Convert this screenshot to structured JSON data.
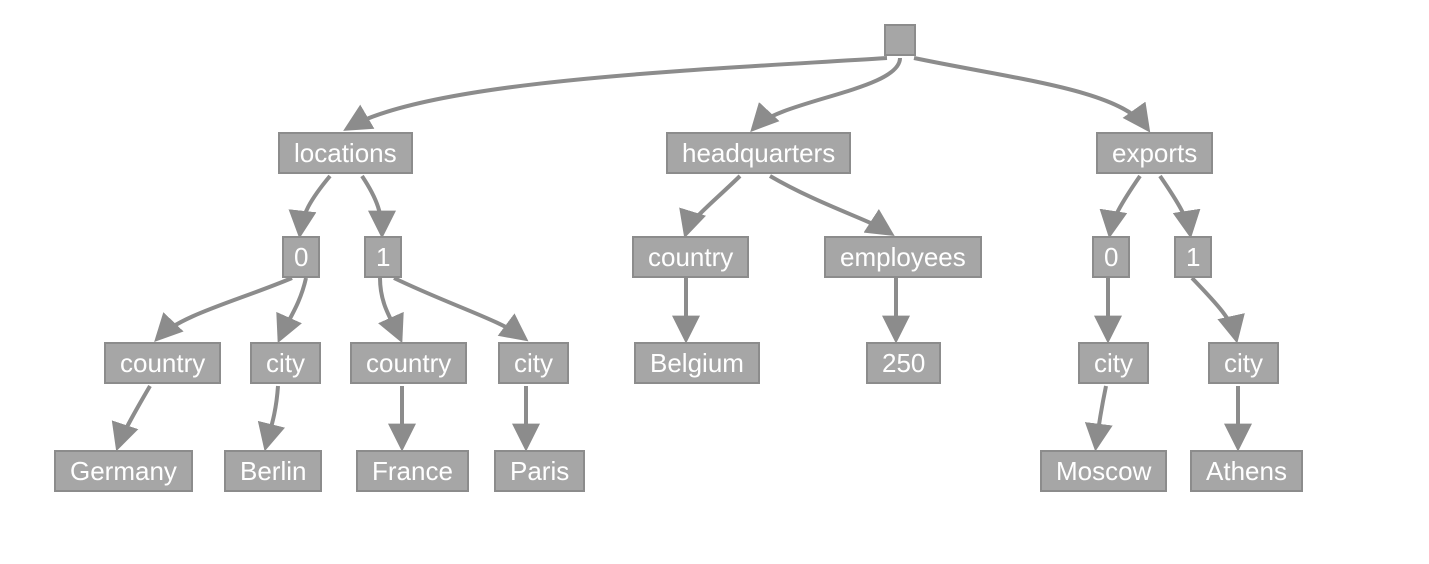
{
  "diagram": {
    "type": "tree",
    "root_label": "",
    "branches": {
      "locations": {
        "label": "locations",
        "idx0": {
          "label": "0",
          "country_label": "country",
          "city_label": "city",
          "country_value": "Germany",
          "city_value": "Berlin"
        },
        "idx1": {
          "label": "1",
          "country_label": "country",
          "city_label": "city",
          "country_value": "France",
          "city_value": "Paris"
        }
      },
      "headquarters": {
        "label": "headquarters",
        "country_label": "country",
        "employees_label": "employees",
        "country_value": "Belgium",
        "employees_value": "250"
      },
      "exports": {
        "label": "exports",
        "idx0": {
          "label": "0",
          "city_label": "city",
          "city_value": "Moscow"
        },
        "idx1": {
          "label": "1",
          "city_label": "city",
          "city_value": "Athens"
        }
      }
    }
  }
}
